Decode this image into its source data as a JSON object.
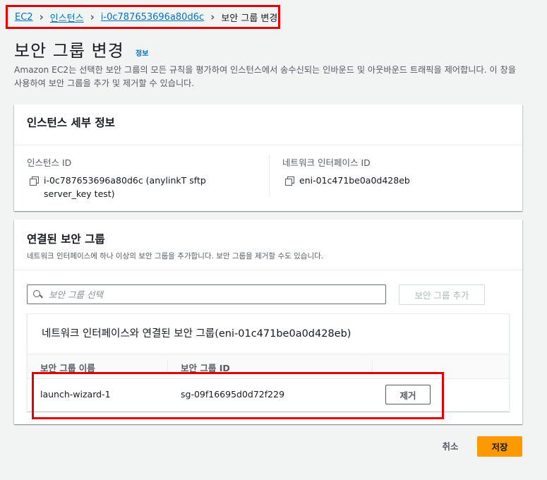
{
  "breadcrumb": {
    "items": [
      "EC2",
      "인스턴스",
      "i-0c787653696a80d6c"
    ],
    "current": "보안 그룹 변경"
  },
  "header": {
    "title": "보안 그룹 변경",
    "info_link": "정보",
    "description": "Amazon EC2는 선택한 보안 그룹의 모든 규칙을 평가하여 인스턴스에서 송수신되는 인바운드 및 아웃바운드 트래픽을 제어합니다. 이 창을 사용하여 보안 그룹을 추가 및 제거할 수 있습니다."
  },
  "instance_details": {
    "title": "인스턴스 세부 정보",
    "instance_id_label": "인스턴스 ID",
    "instance_id_value": "i-0c787653696a80d6c (anylinkT sftp server_key test)",
    "eni_label": "네트워크 인터페이스 ID",
    "eni_value": "eni-01c471be0a0d428eb"
  },
  "security_groups": {
    "title": "연결된 보안 그룹",
    "subtitle": "네트워크 인터페이스에 하나 이상의 보안 그룹을 추가합니다. 보안 그룹을 제거할 수도 있습니다.",
    "search_placeholder": "보안 그룹 선택",
    "add_button": "보안 그룹 추가",
    "table_title": "네트워크 인터페이스와 연결된 보안 그룹(eni-01c471be0a0d428eb)",
    "columns": [
      "보안 그룹 이름",
      "보안 그룹 ID"
    ],
    "rows": [
      {
        "name": "launch-wizard-1",
        "id": "sg-09f16695d0d72f229",
        "action": "제거"
      }
    ]
  },
  "footer": {
    "cancel": "취소",
    "save": "저장"
  },
  "colors": {
    "link": "#0073bb",
    "primary": "#ff9900",
    "highlight": "#e30000"
  }
}
